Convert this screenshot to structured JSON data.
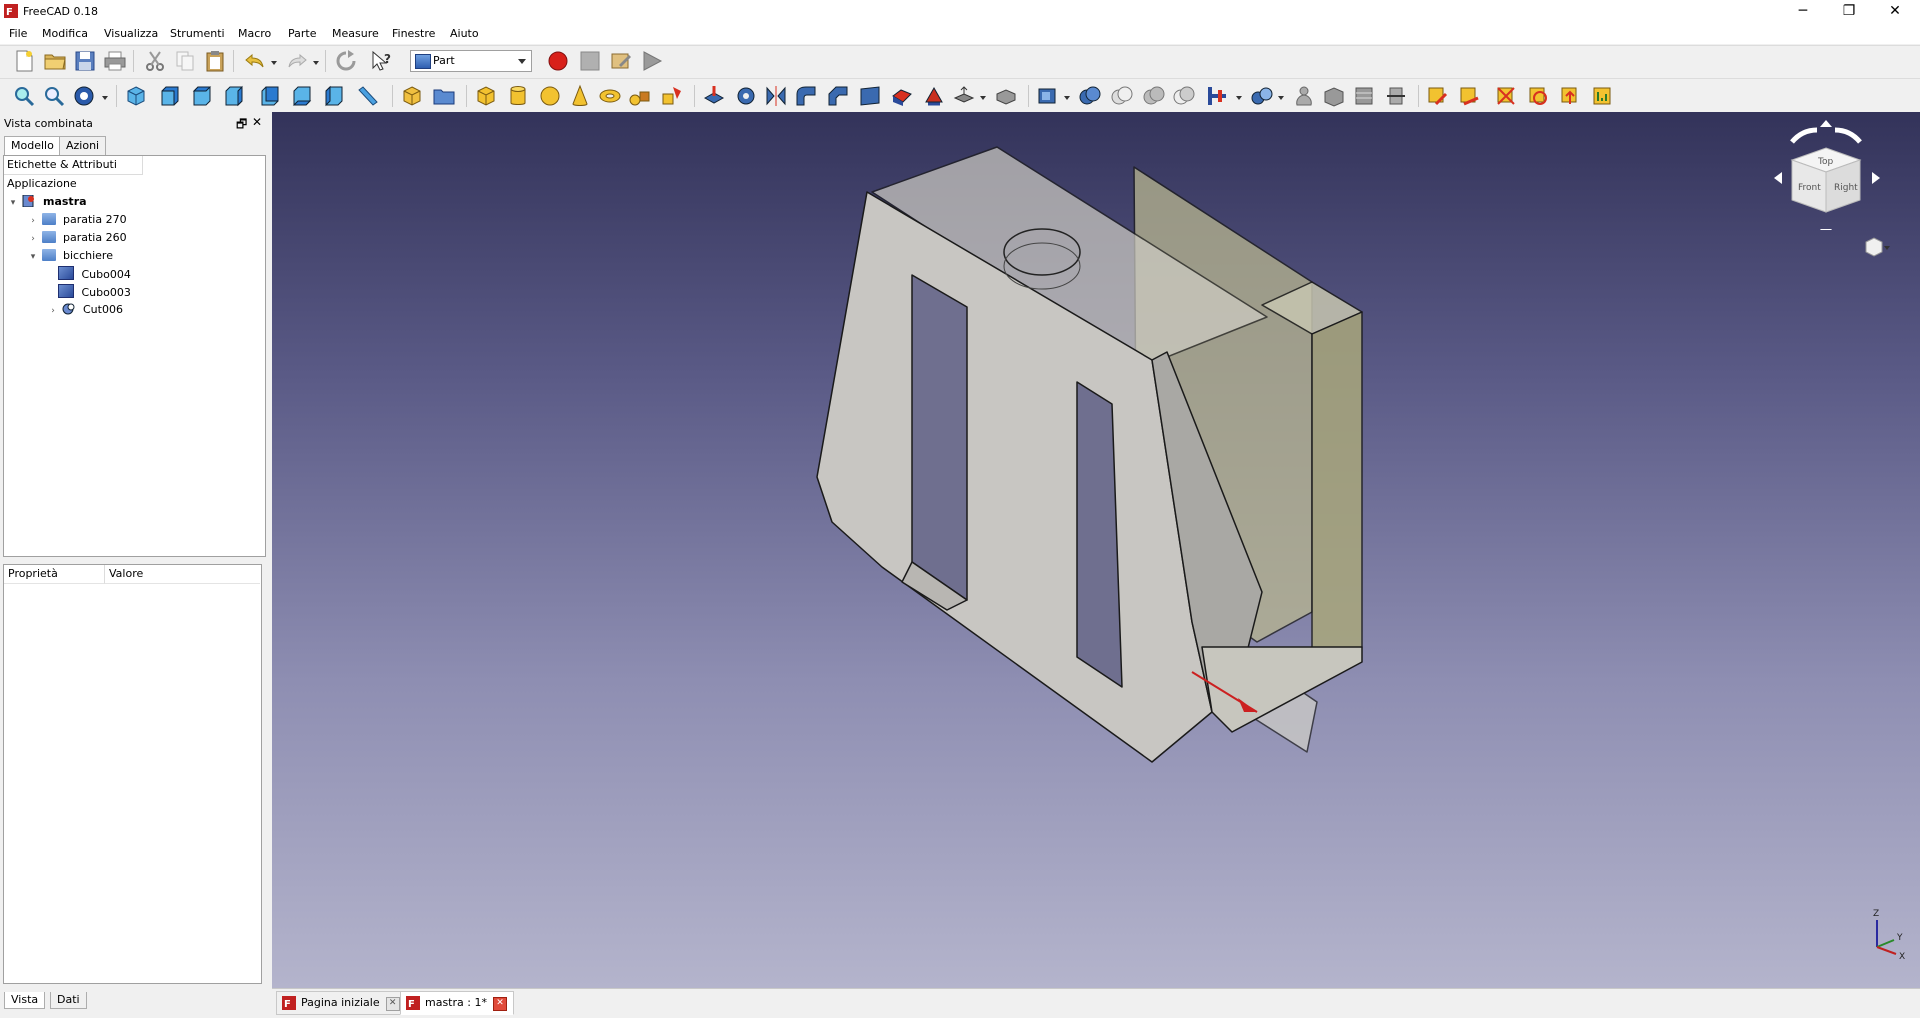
{
  "window": {
    "title": "FreeCAD 0.18",
    "minimize_glyph": "─",
    "maximize_glyph": "❐",
    "close_glyph": "✕"
  },
  "menu": [
    "File",
    "Modifica",
    "Visualizza",
    "Strumenti",
    "Macro",
    "Parte",
    "Measure",
    "Finestre",
    "Aiuto"
  ],
  "toolbar": {
    "workbench": "Part"
  },
  "combo_view": {
    "title": "Vista combinata",
    "float_glyph": "🗗",
    "close_glyph": "✕",
    "tabs": [
      "Modello",
      "Azioni"
    ],
    "tree_header": "Etichette & Attributi",
    "section_label": "Applicazione",
    "items": [
      {
        "label": "mastra",
        "twist": "▾",
        "icon": "document-icon"
      },
      {
        "label": "paratia 270",
        "twist": "›",
        "icon": "folder-icon"
      },
      {
        "label": "paratia 260",
        "twist": "›",
        "icon": "folder-icon"
      },
      {
        "label": "bicchiere",
        "twist": "▾",
        "icon": "folder-icon"
      },
      {
        "label": "Cubo004",
        "twist": "",
        "icon": "box-icon"
      },
      {
        "label": "Cubo003",
        "twist": "",
        "icon": "box-icon"
      },
      {
        "label": "Cut006",
        "twist": "›",
        "icon": "cut-icon"
      }
    ],
    "props_headers": [
      "Proprietà",
      "Valore"
    ],
    "bottom_tabs": [
      "Vista",
      "Dati"
    ]
  },
  "navcube": {
    "faces": [
      "Top",
      "Front",
      "Right"
    ]
  },
  "axis_labels": [
    "Z",
    "Y",
    "X"
  ],
  "doc_tabs": [
    {
      "label": "Pagina iniziale",
      "close": "✕"
    },
    {
      "label": "mastra : 1*",
      "close": "✕"
    }
  ],
  "colors": {
    "viewport_top": "#33335a",
    "viewport_bottom": "#b4b4cc",
    "part_face": "#c8c6c2",
    "part_edge": "#1a1a1a",
    "transparent_face": "#b8b690"
  }
}
